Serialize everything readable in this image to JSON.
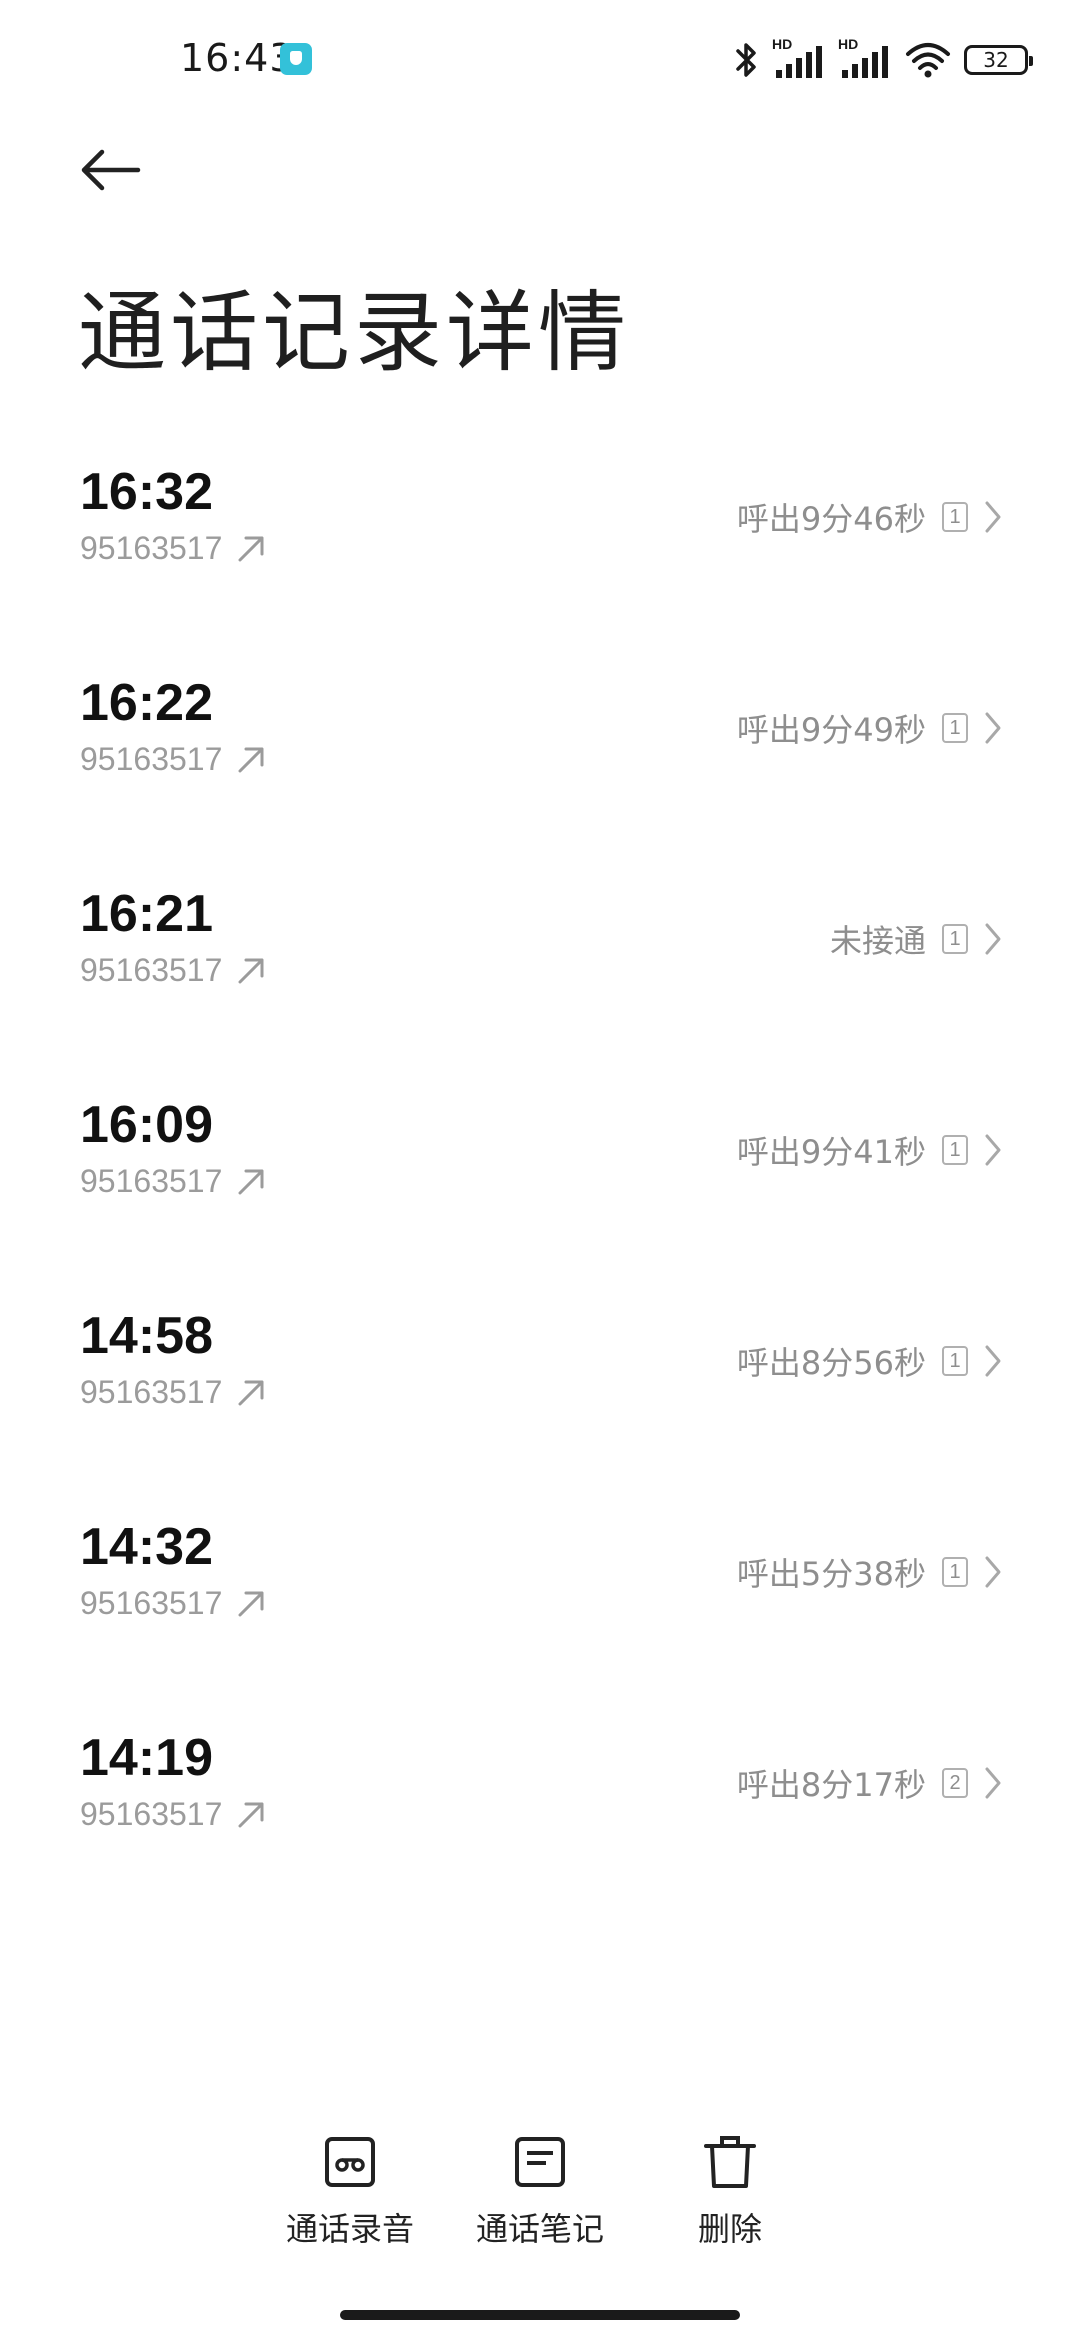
{
  "status_bar": {
    "time": "16:43",
    "battery": "32",
    "hd1": "HD",
    "hd2": "HD"
  },
  "header": {
    "title": "通话记录详情"
  },
  "calls": [
    {
      "time": "16:32",
      "number": "95163517",
      "status": "呼出9分46秒",
      "sim": "1"
    },
    {
      "time": "16:22",
      "number": "95163517",
      "status": "呼出9分49秒",
      "sim": "1"
    },
    {
      "time": "16:21",
      "number": "95163517",
      "status": "未接通",
      "sim": "1"
    },
    {
      "time": "16:09",
      "number": "95163517",
      "status": "呼出9分41秒",
      "sim": "1"
    },
    {
      "time": "14:58",
      "number": "95163517",
      "status": "呼出8分56秒",
      "sim": "1"
    },
    {
      "time": "14:32",
      "number": "95163517",
      "status": "呼出5分38秒",
      "sim": "1"
    },
    {
      "time": "14:19",
      "number": "95163517",
      "status": "呼出8分17秒",
      "sim": "2"
    }
  ],
  "toolbar": {
    "recording_label": "通话录音",
    "notes_label": "通话笔记",
    "delete_label": "删除"
  },
  "icons": {
    "back": "arrow-left-icon",
    "outgoing": "outgoing-call-arrow-icon",
    "chevron": "chevron-right-icon",
    "recording": "voicemail-recording-icon",
    "notes": "note-icon",
    "delete": "trash-icon"
  },
  "colors": {
    "app_badge": "#33c1d9",
    "secondary_text": "#9b9b9b",
    "primary_text": "#111111"
  }
}
